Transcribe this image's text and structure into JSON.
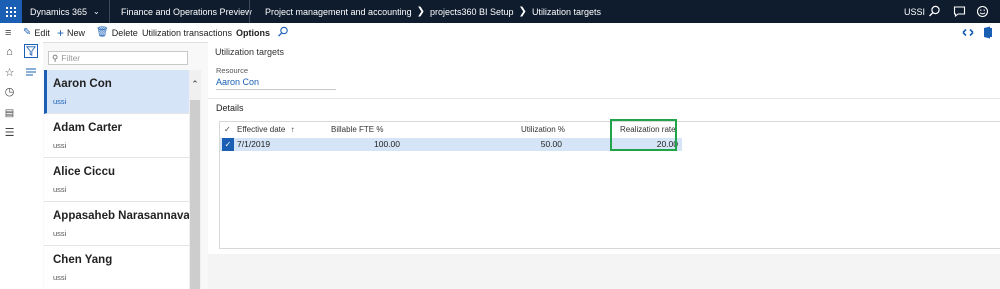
{
  "topbar": {
    "app_name": "Dynamics 365",
    "env_name": "Finance and Operations Preview",
    "breadcrumbs": [
      "Project management and accounting",
      "projects360 BI Setup",
      "Utilization targets"
    ],
    "company": "USSI"
  },
  "actionbar": {
    "edit": "Edit",
    "new": "New",
    "delete": "Delete",
    "utilization_transactions": "Utilization transactions",
    "options": "Options"
  },
  "filter": {
    "placeholder": "Filter"
  },
  "list": [
    {
      "name": "Aaron Con",
      "sub": "ussi",
      "selected": true
    },
    {
      "name": "Adam Carter",
      "sub": "ussi",
      "selected": false
    },
    {
      "name": "Alice Ciccu",
      "sub": "ussi",
      "selected": false
    },
    {
      "name": "Appasaheb Narasannavar",
      "sub": "ussi",
      "selected": false
    },
    {
      "name": "Chen Yang",
      "sub": "ussi",
      "selected": false
    }
  ],
  "details": {
    "page_title": "Utilization targets",
    "resource_label": "Resource",
    "resource_value": "Aaron Con",
    "section_label": "Details",
    "columns": [
      "Effective date",
      "Billable FTE %",
      "Utilization %",
      "Realization rate"
    ],
    "sort_indicator": "↑",
    "rows": [
      {
        "effective_date": "7/1/2019",
        "billable_fte": "100.00",
        "utilization": "50.00",
        "realization_rate": "20.00"
      }
    ]
  },
  "colors": {
    "accent": "#1a5fb4",
    "highlight": "#21a34a",
    "navbar": "#0f1c2e",
    "selected_row": "#d6e4f7"
  }
}
